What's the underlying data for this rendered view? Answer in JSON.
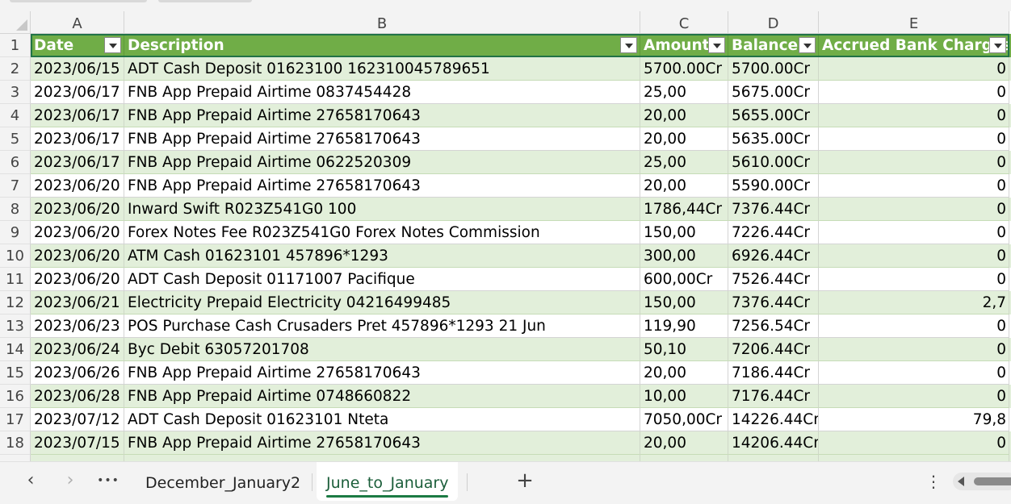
{
  "columns": [
    {
      "letter": "A",
      "header": "Date"
    },
    {
      "letter": "B",
      "header": "Description"
    },
    {
      "letter": "C",
      "header": "Amount"
    },
    {
      "letter": "D",
      "header": "Balance"
    },
    {
      "letter": "E",
      "header": "Accrued Bank Charges"
    }
  ],
  "row_numbers": [
    "1",
    "2",
    "3",
    "4",
    "5",
    "6",
    "7",
    "8",
    "9",
    "10",
    "11",
    "12",
    "13",
    "14",
    "15",
    "16",
    "17",
    "18"
  ],
  "rows": [
    [
      "2023/06/15",
      "ADT Cash Deposit 01623100 162310045789651",
      "5700.00Cr",
      "5700.00Cr",
      "0"
    ],
    [
      "2023/06/17",
      "FNB App Prepaid Airtime 0837454428",
      "25,00",
      "5675.00Cr",
      "0"
    ],
    [
      "2023/06/17",
      "FNB App Prepaid Airtime 27658170643",
      "20,00",
      "5655.00Cr",
      "0"
    ],
    [
      "2023/06/17",
      "FNB App Prepaid Airtime 27658170643",
      "20,00",
      "5635.00Cr",
      "0"
    ],
    [
      "2023/06/17",
      "FNB App Prepaid Airtime 0622520309",
      "25,00",
      "5610.00Cr",
      "0"
    ],
    [
      "2023/06/20",
      "FNB App Prepaid Airtime 27658170643",
      "20,00",
      "5590.00Cr",
      "0"
    ],
    [
      "2023/06/20",
      "Inward Swift R023Z541G0 100",
      "1786,44Cr",
      "7376.44Cr",
      "0"
    ],
    [
      "2023/06/20",
      "Forex Notes Fee R023Z541G0 Forex Notes Commission",
      "150,00",
      "7226.44Cr",
      "0"
    ],
    [
      "2023/06/20",
      "ATM Cash 01623101 457896*1293",
      "300,00",
      "6926.44Cr",
      "0"
    ],
    [
      "2023/06/20",
      "ADT Cash Deposit 01171007 Pacifique",
      "600,00Cr",
      "7526.44Cr",
      "0"
    ],
    [
      "2023/06/21",
      "Electricity Prepaid Electricity 04216499485",
      "150,00",
      "7376.44Cr",
      "2,7"
    ],
    [
      "2023/06/23",
      "POS Purchase Cash Crusaders Pret 457896*1293 21 Jun",
      "119,90",
      "7256.54Cr",
      "0"
    ],
    [
      "2023/06/24",
      "Byc Debit 63057201708",
      "50,10",
      "7206.44Cr",
      "0"
    ],
    [
      "2023/06/26",
      "FNB App Prepaid Airtime 27658170643",
      "20,00",
      "7186.44Cr",
      "0"
    ],
    [
      "2023/06/28",
      "FNB App Prepaid Airtime 0748660822",
      "10,00",
      "7176.44Cr",
      "0"
    ],
    [
      "2023/07/12",
      "ADT Cash Deposit 01623101 Nteta",
      "7050,00Cr",
      "14226.44Cr",
      "79,8"
    ],
    [
      "2023/07/15",
      "FNB App Prepaid Airtime 27658170643",
      "20,00",
      "14206.44Cr",
      "0"
    ]
  ],
  "tabs": {
    "sheet1": "December_January2",
    "sheet2": "June_to_January",
    "active": "June_to_January"
  },
  "nav": {
    "prev": "‹",
    "next": "›",
    "more": "•••",
    "add": "+",
    "options": "⋮"
  },
  "colors": {
    "header_green": "#70ad47",
    "band_green": "#e2efda",
    "active_tab_underline": "#1b7a43"
  }
}
